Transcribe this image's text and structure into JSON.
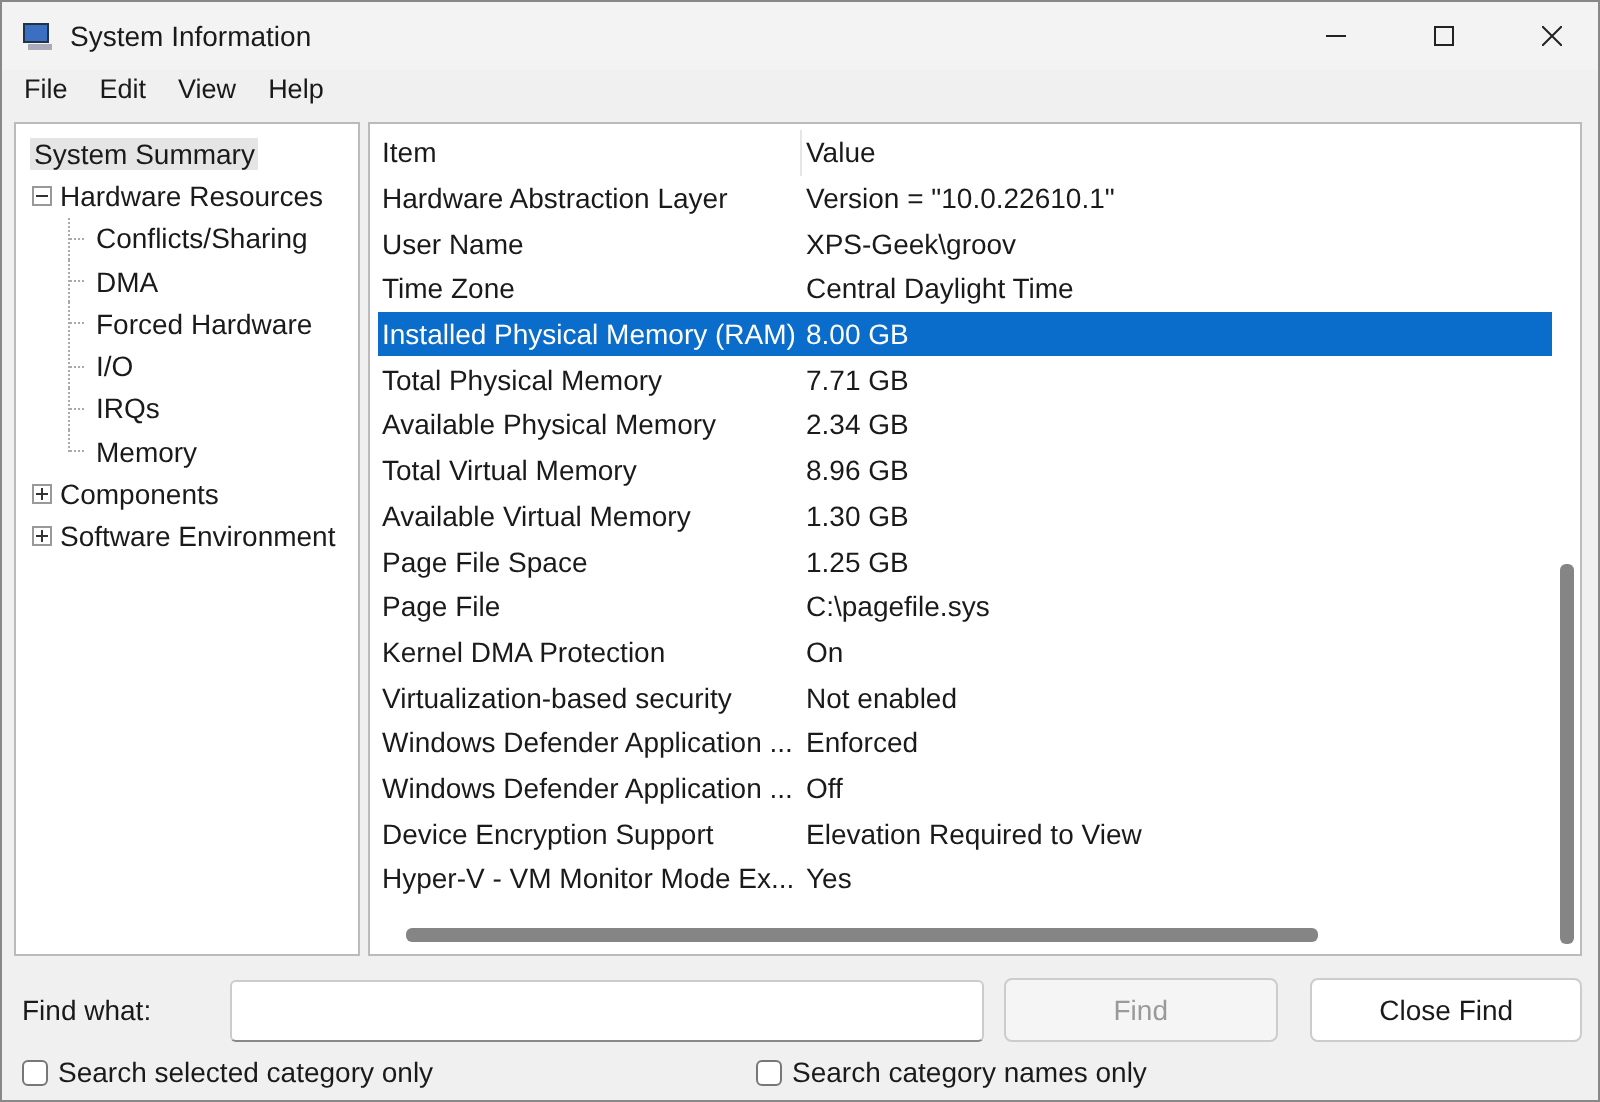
{
  "window": {
    "title": "System Information"
  },
  "menu": [
    "File",
    "Edit",
    "View",
    "Help"
  ],
  "tree": [
    {
      "label": "System Summary",
      "selected": true
    },
    {
      "label": "Hardware Resources",
      "expanded": true,
      "selected": false,
      "children": [
        {
          "label": "Conflicts/Sharing",
          "selected": false
        },
        {
          "label": "DMA",
          "selected": false
        },
        {
          "label": "Forced Hardware",
          "selected": false
        },
        {
          "label": "I/O",
          "selected": false
        },
        {
          "label": "IRQs",
          "selected": false
        },
        {
          "label": "Memory",
          "selected": false
        }
      ]
    },
    {
      "label": "Components",
      "expanded": false,
      "selected": false
    },
    {
      "label": "Software Environment",
      "expanded": false,
      "selected": false
    }
  ],
  "table": {
    "columns": [
      "Item",
      "Value"
    ],
    "rows": [
      {
        "item": "Hardware Abstraction Layer",
        "value": "Version = \"10.0.22610.1\"",
        "selected": false
      },
      {
        "item": "User Name",
        "value": "XPS-Geek\\groov",
        "selected": false
      },
      {
        "item": "Time Zone",
        "value": "Central Daylight Time",
        "selected": false
      },
      {
        "item": "Installed Physical Memory (RAM)",
        "value": "8.00 GB",
        "selected": true
      },
      {
        "item": "Total Physical Memory",
        "value": "7.71 GB",
        "selected": false
      },
      {
        "item": "Available Physical Memory",
        "value": "2.34 GB",
        "selected": false
      },
      {
        "item": "Total Virtual Memory",
        "value": "8.96 GB",
        "selected": false
      },
      {
        "item": "Available Virtual Memory",
        "value": "1.30 GB",
        "selected": false
      },
      {
        "item": "Page File Space",
        "value": "1.25 GB",
        "selected": false
      },
      {
        "item": "Page File",
        "value": "C:\\pagefile.sys",
        "selected": false
      },
      {
        "item": "Kernel DMA Protection",
        "value": "On",
        "selected": false
      },
      {
        "item": "Virtualization-based security",
        "value": "Not enabled",
        "selected": false
      },
      {
        "item": "Windows Defender Application ...",
        "value": "Enforced",
        "selected": false
      },
      {
        "item": "Windows Defender Application ...",
        "value": "Off",
        "selected": false
      },
      {
        "item": "Device Encryption Support",
        "value": "Elevation Required to View",
        "selected": false
      },
      {
        "item": "Hyper-V - VM Monitor Mode Ex...",
        "value": "Yes",
        "selected": false
      }
    ]
  },
  "find": {
    "label": "Find what:",
    "find_button": {
      "label": "Find",
      "disabled": true
    },
    "close_button": "Close Find",
    "options": [
      {
        "label": "Search selected category only",
        "checked": false
      },
      {
        "label": "Search category names only",
        "checked": false
      }
    ]
  }
}
